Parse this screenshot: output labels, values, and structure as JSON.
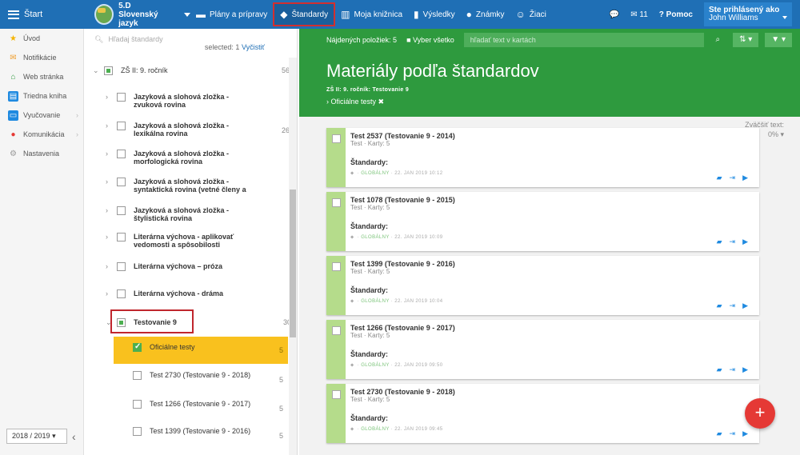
{
  "topbar": {
    "start": "Štart",
    "class_code": "5.D",
    "class_subject": "Slovenský jazyk",
    "nav": [
      {
        "label": "Plány a prípravy",
        "icon": "briefcase-icon",
        "glyph": "▬"
      },
      {
        "label": "Štandardy",
        "icon": "shield-icon",
        "glyph": "◆"
      },
      {
        "label": "Moja knižnica",
        "icon": "library-icon",
        "glyph": "▥"
      },
      {
        "label": "Výsledky",
        "icon": "bar-chart-icon",
        "glyph": "▮"
      },
      {
        "label": "Známky",
        "icon": "grade-icon",
        "glyph": "●"
      },
      {
        "label": "Žiaci",
        "icon": "students-icon",
        "glyph": "☺"
      }
    ],
    "message_count": "11",
    "help": "Pomoc",
    "signed_in_label": "Ste prihlásený ako",
    "user_name": "John Williams"
  },
  "sidebar": {
    "items": [
      {
        "label": "Úvod",
        "icon": "star-icon",
        "color": "#f5b400",
        "glyph": "★"
      },
      {
        "label": "Notifikácie",
        "icon": "envelope-icon",
        "color": "#f0a030",
        "glyph": "✉"
      },
      {
        "label": "Web stránka",
        "icon": "home-icon",
        "color": "#2e9a3e",
        "glyph": "⌂"
      },
      {
        "label": "Triedna kniha",
        "icon": "book-icon",
        "color": "#1f8ae0",
        "glyph": "▤"
      },
      {
        "label": "Vyučovanie",
        "icon": "teaching-icon",
        "color": "#1f8ae0",
        "glyph": "▭"
      },
      {
        "label": "Komunikácia",
        "icon": "chat-icon",
        "color": "#e53935",
        "glyph": "●"
      },
      {
        "label": "Nastavenia",
        "icon": "gear-icon",
        "color": "#999999",
        "glyph": "⚙"
      }
    ],
    "year": "2018 / 2019"
  },
  "tree": {
    "search_placeholder": "Hľadaj štandardy",
    "selected_label": "selected: 1",
    "clear_label": "Vyčistiť",
    "root": {
      "label": "ZŠ II: 9. ročník",
      "count": "56"
    },
    "items": [
      {
        "label": "Jazyková a slohová zložka - zvuková rovina",
        "count": ""
      },
      {
        "label": "Jazyková a slohová zložka - lexikálna rovina",
        "count": "26"
      },
      {
        "label": "Jazyková a slohová zložka - morfologická rovina",
        "count": ""
      },
      {
        "label": "Jazyková a slohová zložka - syntaktická rovina (vetné členy a",
        "count": ""
      },
      {
        "label": "Jazyková a slohová zložka - štylistická rovina",
        "count": ""
      },
      {
        "label": "Literárna výchova - aplikovať vedomosti a spôsobilosti",
        "count": ""
      },
      {
        "label": "Literárna výchova – próza",
        "count": ""
      },
      {
        "label": "Literárna výchova - dráma",
        "count": ""
      }
    ],
    "testing": {
      "label": "Testovanie 9",
      "count": "30"
    },
    "children": [
      {
        "label": "Oficiálne testy",
        "count": "5"
      },
      {
        "label": "Test 2730 (Testovanie 9 - 2018)",
        "count": "5"
      },
      {
        "label": "Test 1266 (Testovanie 9 - 2017)",
        "count": "5"
      },
      {
        "label": "Test 1399 (Testovanie 9 - 2016)",
        "count": "5"
      }
    ]
  },
  "main": {
    "found_label": "Nájdených položiek: 5",
    "select_all": "Vyber všetko",
    "search_placeholder": "hľadať text v kartách",
    "title": "Materiály podľa štandardov",
    "subtitle": "ZŠ II: 9. ročník: Testovanie 9",
    "filter_chip": "Oficiálne testy",
    "zoom_label": "Zväčšiť text:",
    "zoom_value": "0%",
    "standards_label": "Štandardy:",
    "cards": [
      {
        "title": "Test 2537 (Testovanie 9 - 2014)",
        "sub": "Test · Karty: 5",
        "scope": "GLOBÁLNY",
        "date": "22. JAN 2019 10:12"
      },
      {
        "title": "Test 1078 (Testovanie 9 - 2015)",
        "sub": "Test · Karty: 5",
        "scope": "GLOBÁLNY",
        "date": "22. JAN 2019 10:09"
      },
      {
        "title": "Test 1399 (Testovanie 9 - 2016)",
        "sub": "Test · Karty: 5",
        "scope": "GLOBÁLNY",
        "date": "22. JAN 2019 10:04"
      },
      {
        "title": "Test 1266 (Testovanie 9 - 2017)",
        "sub": "Test · Karty: 5",
        "scope": "GLOBÁLNY",
        "date": "22. JAN 2019 09:50"
      },
      {
        "title": "Test 2730 (Testovanie 9 - 2018)",
        "sub": "Test · Karty: 5",
        "scope": "GLOBÁLNY",
        "date": "22. JAN 2019 09:45"
      }
    ]
  },
  "colors": {
    "topbar": "#1f6fb5",
    "header": "#2e9a3e",
    "highlight": "#f9c11e",
    "card_strip": "#b5dc8b",
    "fab": "#e53935"
  }
}
